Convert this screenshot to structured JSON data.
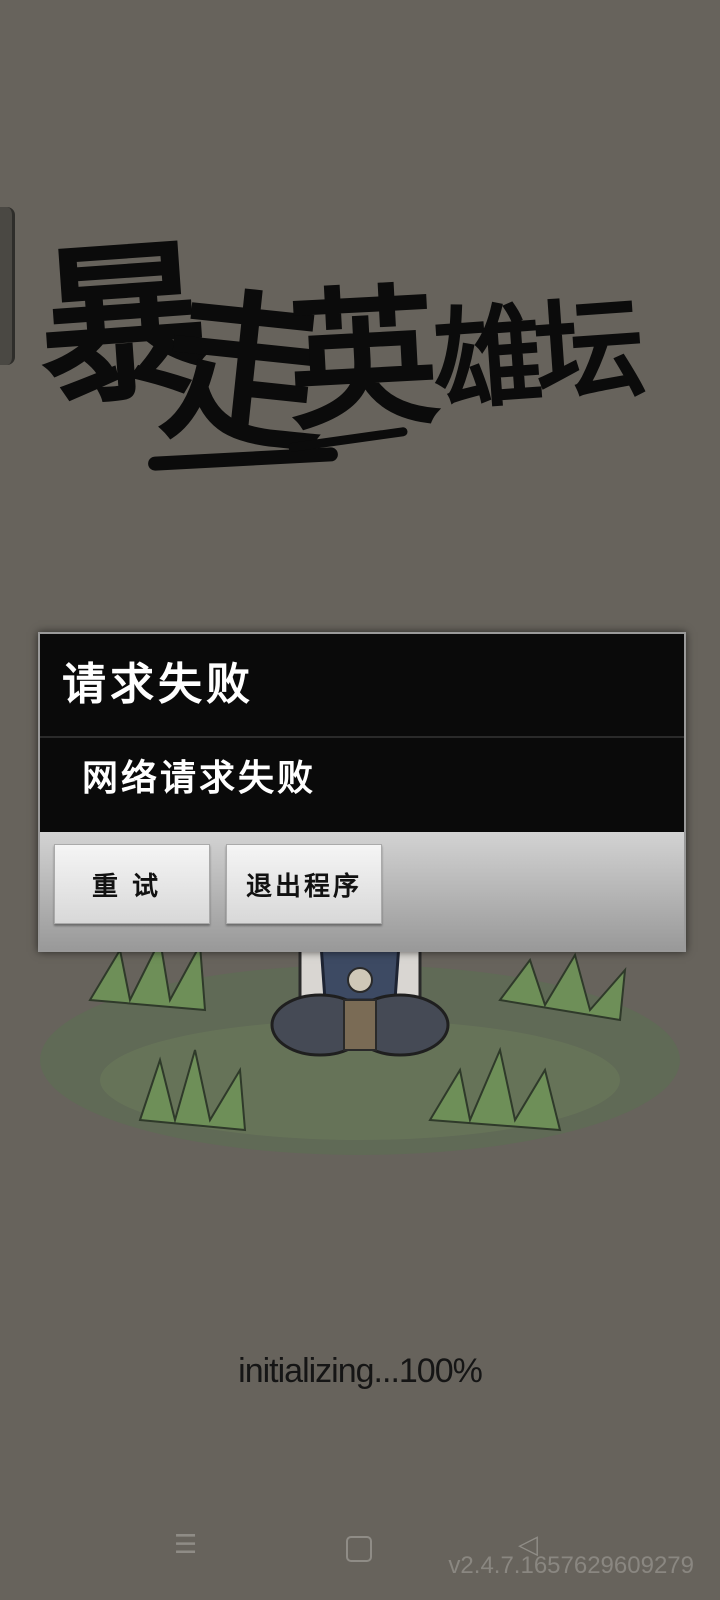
{
  "logo": {
    "char1": "暴",
    "char2": "走",
    "char3": "英",
    "char4": "雄坛"
  },
  "dialog": {
    "title": "请求失败",
    "message": "网络请求失败",
    "retry_label": "重试",
    "exit_label": "退出程序"
  },
  "loading": {
    "status_text": "initializing...100%"
  },
  "nav": {
    "menu_icon": "☰",
    "back_icon": "◁"
  },
  "version": "v2.4.7.1657629609279",
  "colors": {
    "background": "#67635c",
    "dialog_bg": "#0a0a0a",
    "dialog_text": "#ffffff",
    "button_bar": "#bdbdbd"
  }
}
